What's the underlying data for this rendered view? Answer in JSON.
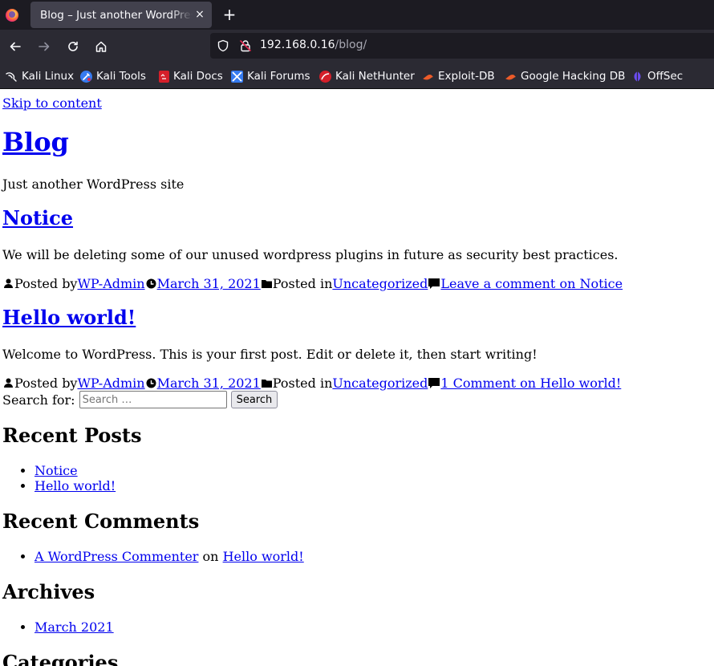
{
  "browser": {
    "tab_title": "Blog – Just another WordPress site",
    "tab_close": "×",
    "new_tab": "+",
    "url_host": "192.168.0.16",
    "url_path": "/blog/",
    "bookmarks": [
      {
        "label": "Kali Linux",
        "icon": "kali-dragon-icon"
      },
      {
        "label": "Kali Tools",
        "icon": "kali-tools-icon"
      },
      {
        "label": "Kali Docs",
        "icon": "kali-docs-icon"
      },
      {
        "label": "Kali Forums",
        "icon": "kali-forums-icon"
      },
      {
        "label": "Kali NetHunter",
        "icon": "nethunter-icon"
      },
      {
        "label": "Exploit-DB",
        "icon": "exploit-db-icon"
      },
      {
        "label": "Google Hacking DB",
        "icon": "ghdb-icon"
      },
      {
        "label": "OffSec",
        "icon": "offsec-icon"
      }
    ]
  },
  "page": {
    "skip_link": "Skip to content",
    "site_title": "Blog",
    "tagline": "Just another WordPress site",
    "posts": [
      {
        "title": "Notice",
        "body": "We will be deleting some of our unused wordpress plugins in future as security best practices.",
        "posted_by_label": "Posted by",
        "author": "WP-Admin",
        "date": "March 31, 2021",
        "posted_in_label": "Posted in",
        "category": "Uncategorized",
        "comment_link": "Leave a comment on Notice"
      },
      {
        "title": "Hello world!",
        "body": "Welcome to WordPress. This is your first post. Edit or delete it, then start writing!",
        "posted_by_label": "Posted by",
        "author": "WP-Admin",
        "date": "March 31, 2021",
        "posted_in_label": "Posted in",
        "category": "Uncategorized",
        "comment_link": "1 Comment on Hello world!"
      }
    ],
    "search": {
      "label": "Search for:",
      "placeholder": "Search …",
      "value": "",
      "button": "Search"
    },
    "recent_posts": {
      "heading": "Recent Posts",
      "items": [
        "Notice",
        "Hello world!"
      ]
    },
    "recent_comments": {
      "heading": "Recent Comments",
      "items": [
        {
          "author": "A WordPress Commenter",
          "on": "on",
          "post": "Hello world!"
        }
      ]
    },
    "archives": {
      "heading": "Archives",
      "items": [
        "March 2021"
      ]
    },
    "categories": {
      "heading": "Categories"
    }
  }
}
